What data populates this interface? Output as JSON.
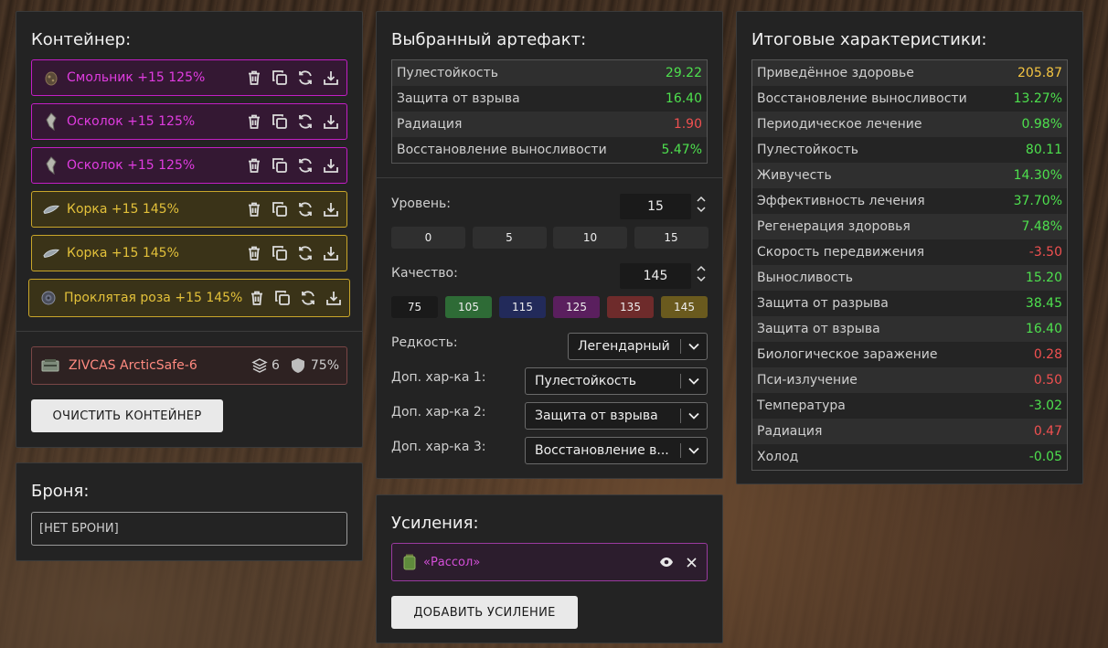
{
  "container": {
    "title": "Контейнер:",
    "items": [
      {
        "label": "Смольник +15 125%",
        "style": "purple",
        "icon": "smolnik-icon"
      },
      {
        "label": "Осколок +15 125%",
        "style": "purple",
        "icon": "shard-icon"
      },
      {
        "label": "Осколок +15 125%",
        "style": "purple",
        "icon": "shard-icon"
      },
      {
        "label": "Корка +15 145%",
        "style": "gold",
        "icon": "crust-icon"
      },
      {
        "label": "Корка +15 145%",
        "style": "gold",
        "icon": "crust-icon"
      },
      {
        "label": "Проклятая роза +15 145%",
        "style": "gold",
        "icon": "cursed-rose-icon"
      }
    ],
    "case": {
      "label": "ZIVCAS ArcticSafe-6",
      "slots": "6",
      "protection": "75%"
    },
    "clear_button": "ОЧИСТИТЬ КОНТЕЙНЕР"
  },
  "armor": {
    "title": "Броня:",
    "value": "[НЕТ БРОНИ]"
  },
  "artifact": {
    "title": "Выбранный артефакт:",
    "stats": [
      {
        "name": "Пулестойкость",
        "value": "29.22",
        "color": "g"
      },
      {
        "name": "Защита от взрыва",
        "value": "16.40",
        "color": "g"
      },
      {
        "name": "Радиация",
        "value": "1.90",
        "color": "r"
      },
      {
        "name": "Восстановление выносливости",
        "value": "5.47%",
        "color": "g"
      }
    ],
    "level_label": "Уровень:",
    "level_value": "15",
    "level_presets": [
      "0",
      "5",
      "10",
      "15"
    ],
    "quality_label": "Качество:",
    "quality_value": "145",
    "quality_presets": [
      {
        "label": "75",
        "color": "#1a1a1a"
      },
      {
        "label": "105",
        "color": "#2e6b36"
      },
      {
        "label": "115",
        "color": "#222a5a"
      },
      {
        "label": "125",
        "color": "#5a1f5e"
      },
      {
        "label": "135",
        "color": "#6e2b2b"
      },
      {
        "label": "145",
        "color": "#6a5a1e"
      }
    ],
    "rarity_label": "Редкость:",
    "rarity_value": "Легендарный",
    "extra1_label": "Доп. хар-ка 1:",
    "extra1_value": "Пулестойкость",
    "extra2_label": "Доп. хар-ка 2:",
    "extra2_value": "Защита от взрыва",
    "extra3_label": "Доп. хар-ка 3:",
    "extra3_value": "Восстановление в..."
  },
  "boosts": {
    "title": "Усиления:",
    "item": "«Рассол»",
    "add_button": "ДОБАВИТЬ УСИЛЕНИЕ"
  },
  "totals": {
    "title": "Итоговые характеристики:",
    "stats": [
      {
        "name": "Приведённое здоровье",
        "value": "205.87",
        "color": "y"
      },
      {
        "name": "Восстановление выносливости",
        "value": "13.27%",
        "color": "g"
      },
      {
        "name": "Периодическое лечение",
        "value": "0.98%",
        "color": "g"
      },
      {
        "name": "Пулестойкость",
        "value": "80.11",
        "color": "g"
      },
      {
        "name": "Живучесть",
        "value": "14.30%",
        "color": "g"
      },
      {
        "name": "Эффективность лечения",
        "value": "37.70%",
        "color": "g"
      },
      {
        "name": "Регенерация здоровья",
        "value": "7.48%",
        "color": "g"
      },
      {
        "name": "Скорость передвижения",
        "value": "-3.50",
        "color": "r"
      },
      {
        "name": "Выносливость",
        "value": "15.20",
        "color": "g"
      },
      {
        "name": "Защита от разрыва",
        "value": "38.45",
        "color": "g"
      },
      {
        "name": "Защита от взрыва",
        "value": "16.40",
        "color": "g"
      },
      {
        "name": "Биологическое заражение",
        "value": "0.28",
        "color": "r"
      },
      {
        "name": "Пси-излучение",
        "value": "0.50",
        "color": "r"
      },
      {
        "name": "Температура",
        "value": "-3.02",
        "color": "g"
      },
      {
        "name": "Радиация",
        "value": "0.47",
        "color": "r"
      },
      {
        "name": "Холод",
        "value": "-0.05",
        "color": "g"
      }
    ]
  }
}
